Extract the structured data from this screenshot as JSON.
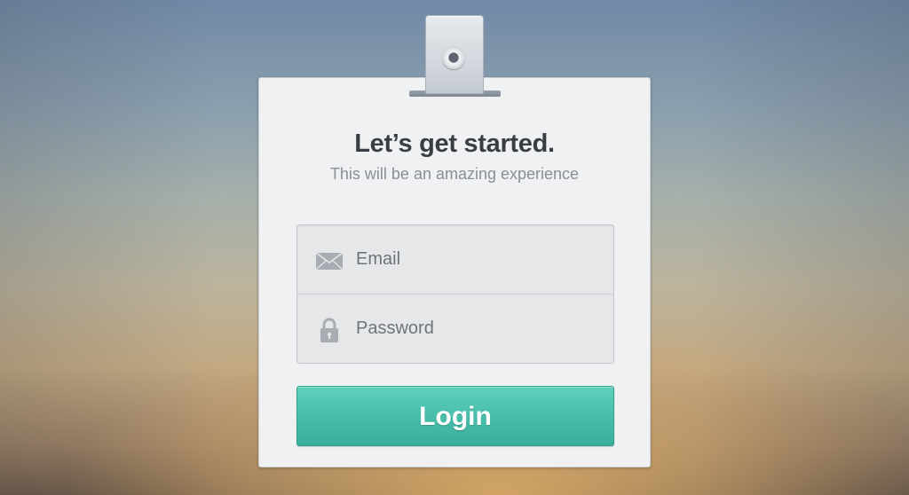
{
  "card": {
    "title": "Let’s get started.",
    "subtitle": "This will be an amazing experience"
  },
  "form": {
    "email_placeholder": "Email",
    "email_icon": "envelope-icon",
    "password_placeholder": "Password",
    "password_icon": "lock-icon",
    "login_label": "Login"
  },
  "colors": {
    "accent": "#4cc3ae",
    "title_text": "#3a3d44",
    "subtitle_text": "#8a8e95",
    "card_background": "#f0f1f3"
  }
}
